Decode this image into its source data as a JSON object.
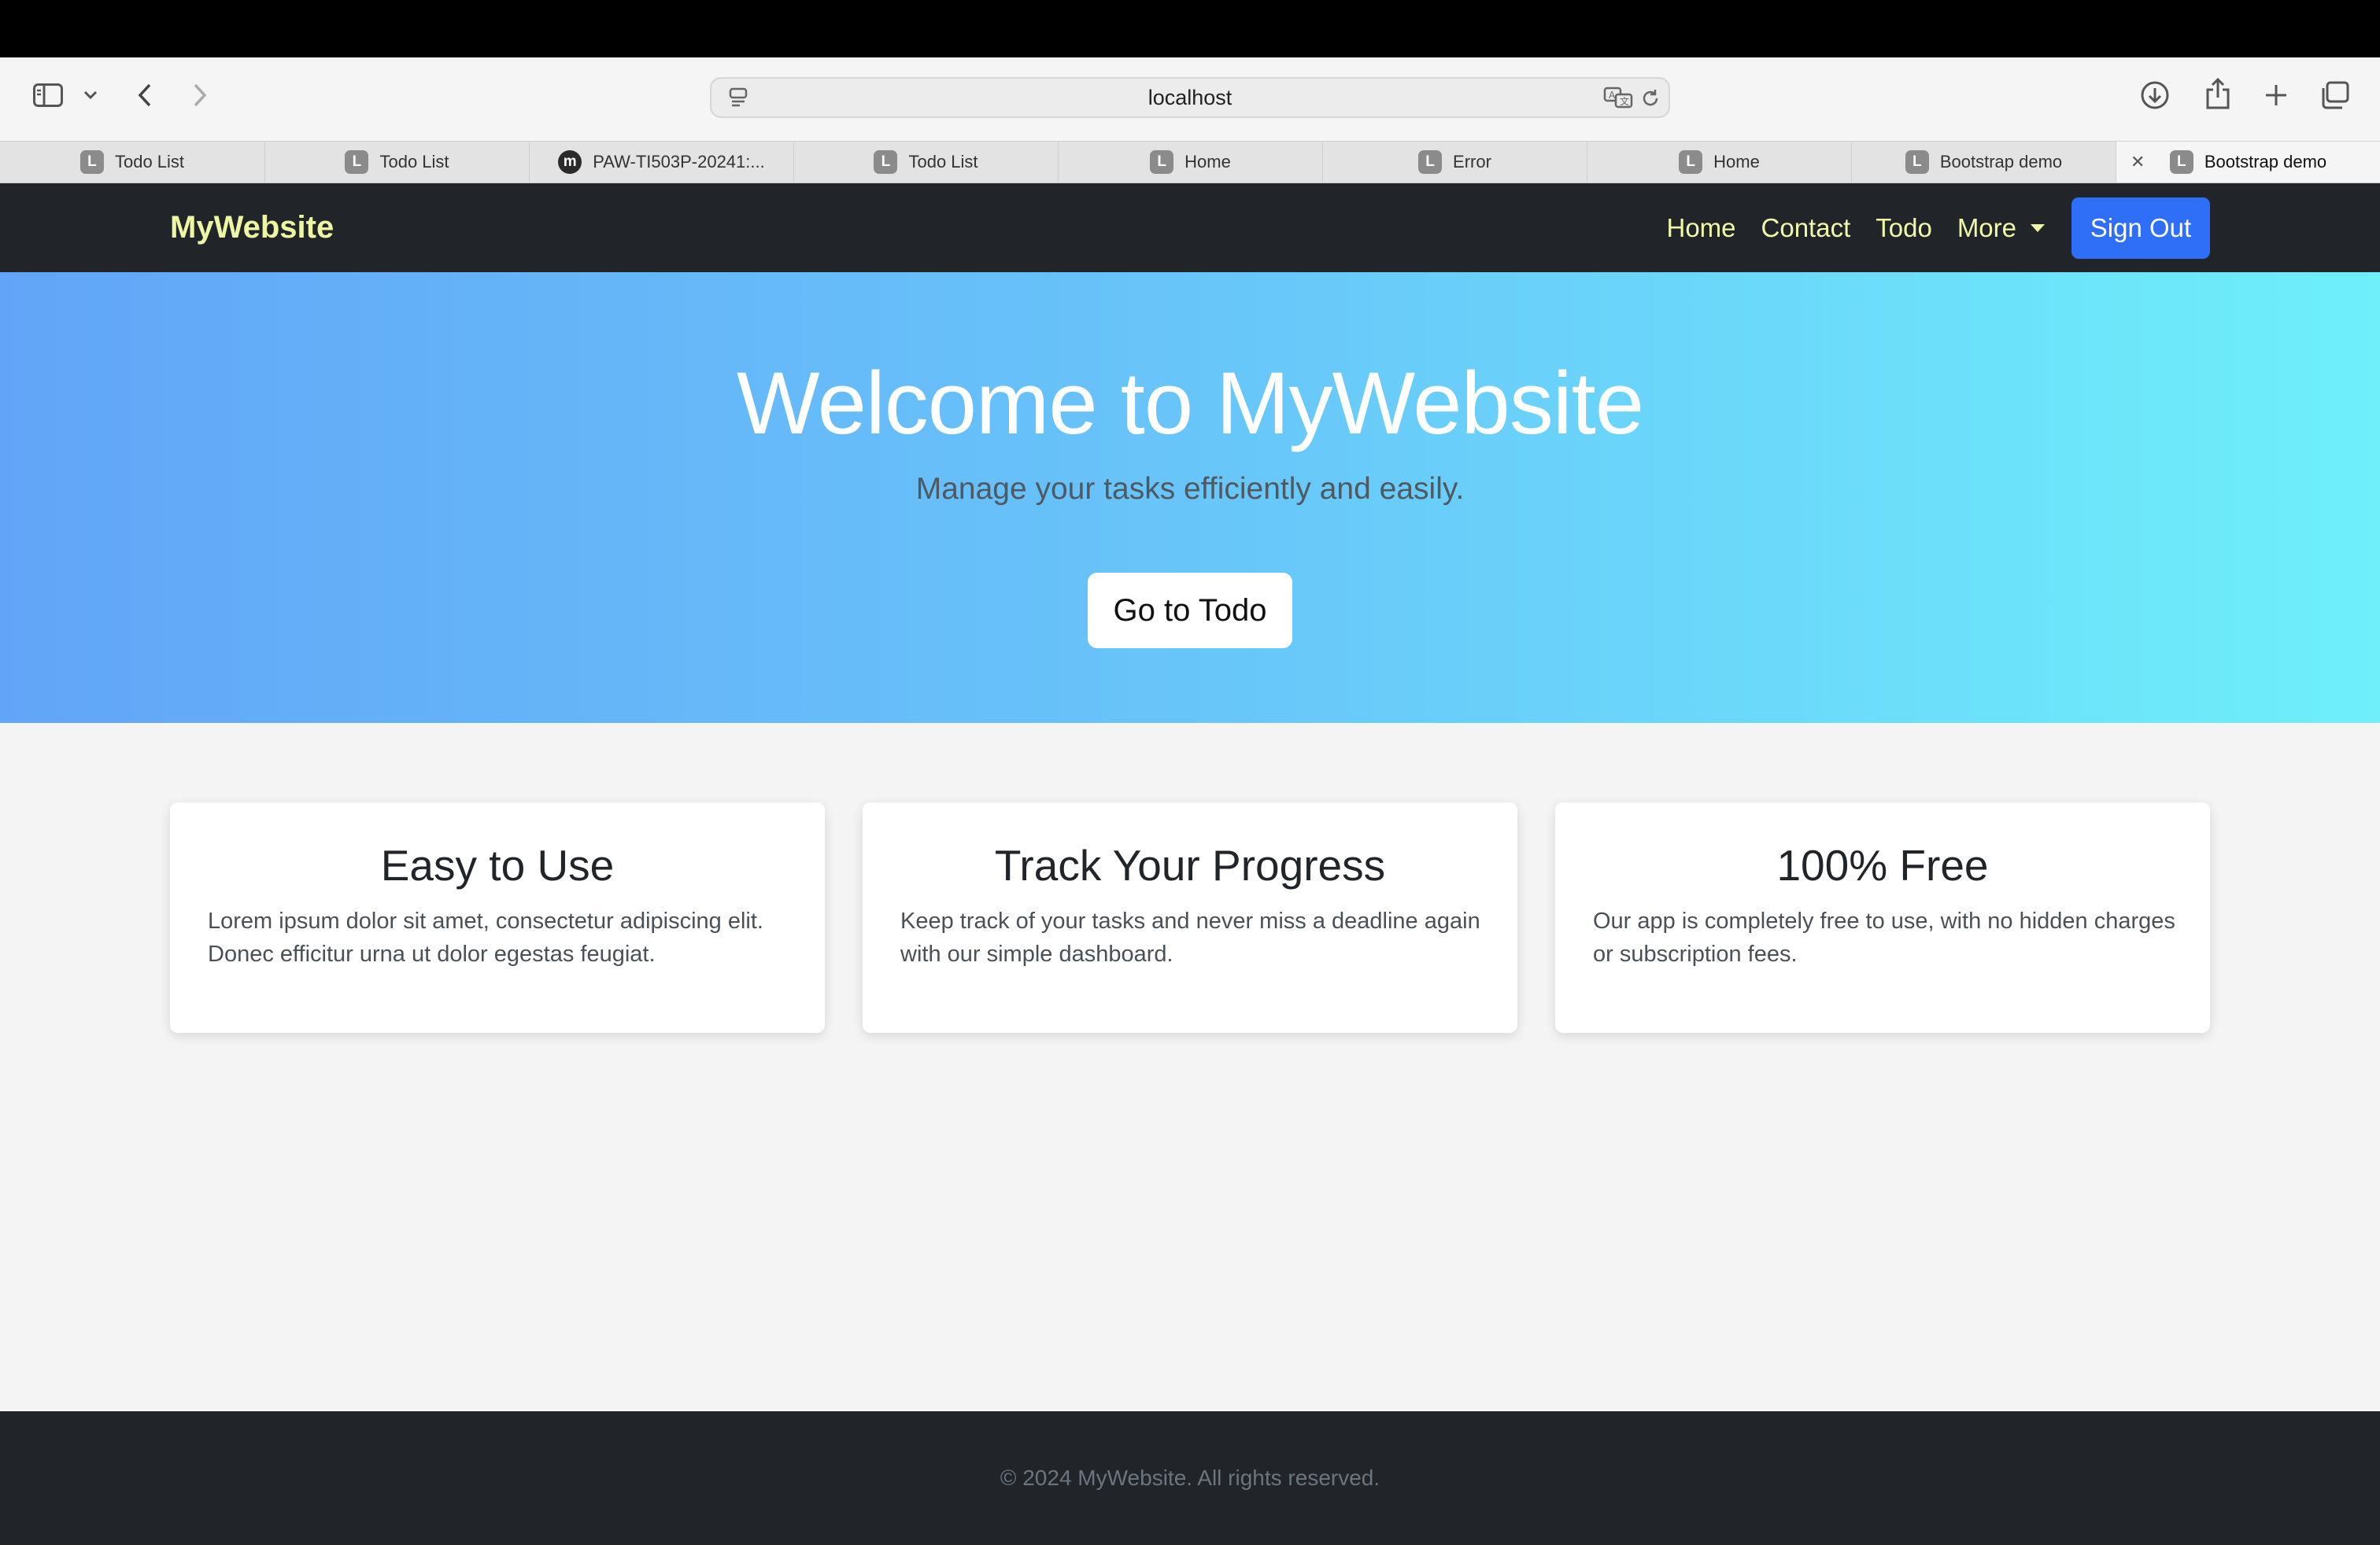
{
  "browser": {
    "address": "localhost",
    "tabs": [
      {
        "label": "Todo List",
        "favicon": "L"
      },
      {
        "label": "Todo List",
        "favicon": "L"
      },
      {
        "label": "PAW-TI503P-20241:...",
        "favicon": "m"
      },
      {
        "label": "Todo List",
        "favicon": "L"
      },
      {
        "label": "Home",
        "favicon": "L"
      },
      {
        "label": "Error",
        "favicon": "L"
      },
      {
        "label": "Home",
        "favicon": "L"
      },
      {
        "label": "Bootstrap demo",
        "favicon": "L"
      },
      {
        "label": "Bootstrap demo",
        "favicon": "L",
        "active": true
      }
    ]
  },
  "navbar": {
    "brand": "MyWebsite",
    "links": [
      "Home",
      "Contact",
      "Todo",
      "More"
    ],
    "signout": "Sign Out"
  },
  "hero": {
    "title": "Welcome to MyWebsite",
    "subtitle": "Manage your tasks efficiently and easily.",
    "button": "Go to Todo"
  },
  "cards": [
    {
      "title": "Easy to Use",
      "text": "Lorem ipsum dolor sit amet, consectetur adipiscing elit. Donec efficitur urna ut dolor egestas feugiat."
    },
    {
      "title": "Track Your Progress",
      "text": "Keep track of your tasks and never miss a deadline again with our simple dashboard."
    },
    {
      "title": "100% Free",
      "text": "Our app is completely free to use, with no hidden charges or subscription fees."
    }
  ],
  "footer": {
    "text": "© 2024 MyWebsite. All rights reserved."
  },
  "colors": {
    "navbar_bg": "#212529",
    "brand_text": "#eef5a3",
    "signout_bg": "#2f6ef7",
    "hero_gradient_start": "#62a5f8",
    "hero_gradient_end": "#6eeffa"
  }
}
